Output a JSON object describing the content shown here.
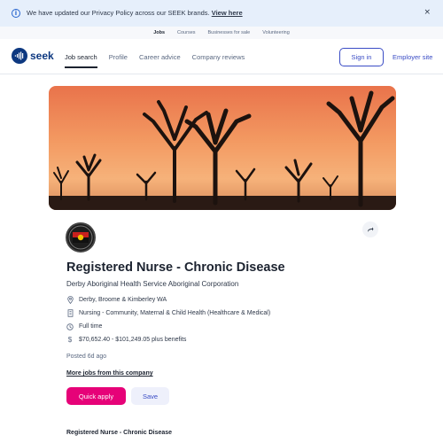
{
  "banner": {
    "message": "We have updated our Privacy Policy across our SEEK brands.",
    "link": "View here",
    "close": "×"
  },
  "subnav": {
    "items": [
      "Jobs",
      "Courses",
      "Businesses for sale",
      "Volunteering"
    ]
  },
  "header": {
    "logo_text": "seek",
    "nav": [
      "Job search",
      "Profile",
      "Career advice",
      "Company reviews"
    ],
    "signin": "Sign in",
    "employer": "Employer site"
  },
  "job": {
    "title": "Registered Nurse - Chronic Disease",
    "company": "Derby Aboriginal Health Service Aboriginal Corporation",
    "location": "Derby, Broome & Kimberley WA",
    "classification": "Nursing - Community, Maternal & Child Health (Healthcare & Medical)",
    "work_type": "Full time",
    "salary": "$70,652.40 - $101,249.05 plus benefits",
    "posted": "Posted 6d ago",
    "more_jobs": "More jobs from this company",
    "apply": "Quick apply",
    "save": "Save",
    "description_heading": "Registered Nurse - Chronic Disease"
  },
  "colors": {
    "brand_navy": "#0d3880",
    "link_blue": "#3a4cc5",
    "apply_pink": "#e60278",
    "banner_bg": "#e6effb"
  }
}
